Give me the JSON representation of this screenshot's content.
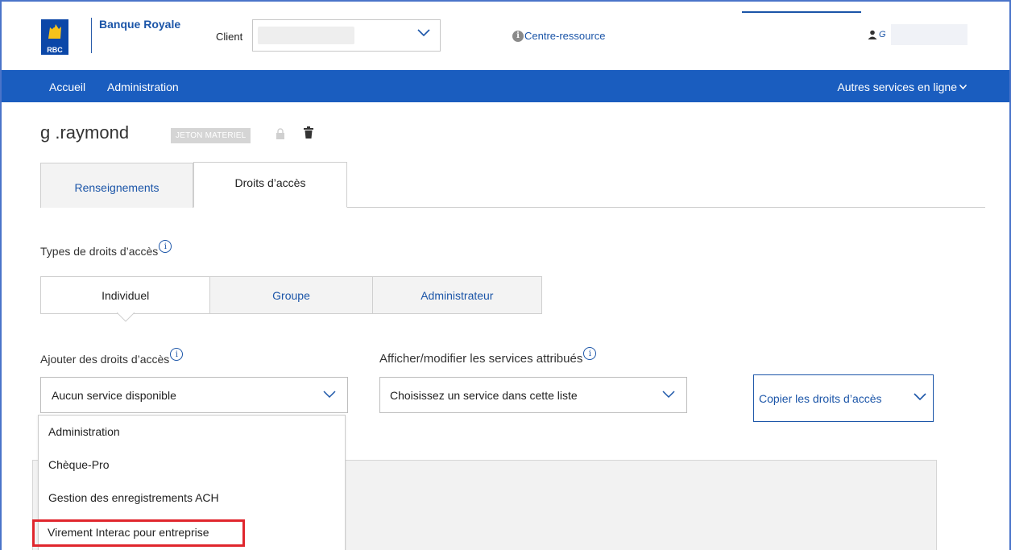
{
  "header": {
    "logo_text": "RBC",
    "brand": "Banque Royale",
    "client_label": "Client",
    "client_value": "",
    "resource_link": "Centre-ressource",
    "user_initial": "G"
  },
  "nav": {
    "items": [
      "Accueil",
      "Administration"
    ],
    "other_services": "Autres services en ligne"
  },
  "user": {
    "name": "g .raymond",
    "token_badge": "JETON MATERIEL"
  },
  "tabs": {
    "info": "Renseignements",
    "rights": "Droits d’accès"
  },
  "access": {
    "types_label": "Types de droits d’accès",
    "subtabs": [
      "Individuel",
      "Groupe",
      "Administrateur"
    ],
    "add_label": "Ajouter des droits d’accès",
    "view_label": "Afficher/modifier les services attribués",
    "add_select": "Aucun service disponible",
    "view_select": "Choisissez un service dans cette liste",
    "copy_button": "Copier les droits d’accès"
  },
  "dropdown": {
    "items": [
      "Administration",
      "Chèque-Pro",
      "Gestion des enregistrements ACH",
      "Virement Interac pour entreprise"
    ],
    "highlighted_index": 3
  },
  "colors": {
    "brand_blue": "#1a5dbf",
    "link_blue": "#1b55a8",
    "highlight_red": "#e0262d"
  }
}
